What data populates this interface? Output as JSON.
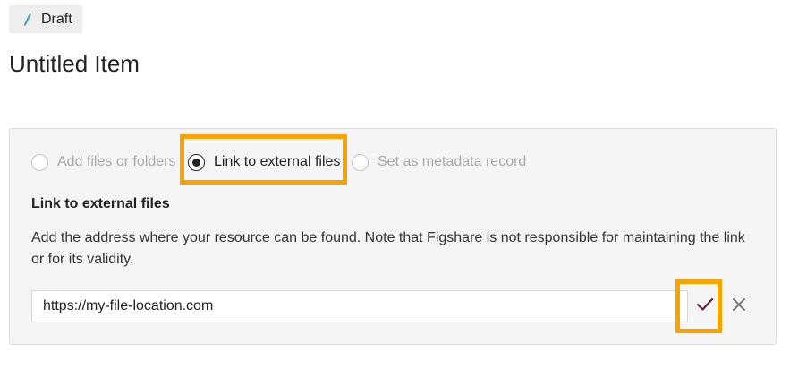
{
  "status": {
    "label": "Draft",
    "icon": "pencil-icon",
    "icon_color": "#4aa3b5"
  },
  "title": "Untitled Item",
  "upload_options": [
    {
      "label": "Add files or folders",
      "state": "disabled",
      "checked": false
    },
    {
      "label": "Link to external files",
      "state": "enabled",
      "checked": true
    },
    {
      "label": "Set as metadata record",
      "state": "disabled",
      "checked": false
    }
  ],
  "section": {
    "heading": "Link to external files",
    "help_text": "Add the address where your resource can be found. Note that Figshare is not responsible for maintaining the link or for its validity."
  },
  "url_field": {
    "value": "https://my-file-location.com"
  },
  "actions": {
    "confirm_icon": "check-icon",
    "clear_icon": "close-icon"
  },
  "colors": {
    "highlight": "#f8a400",
    "confirm": "#6b1d3f",
    "muted": "#a8a8a8"
  }
}
